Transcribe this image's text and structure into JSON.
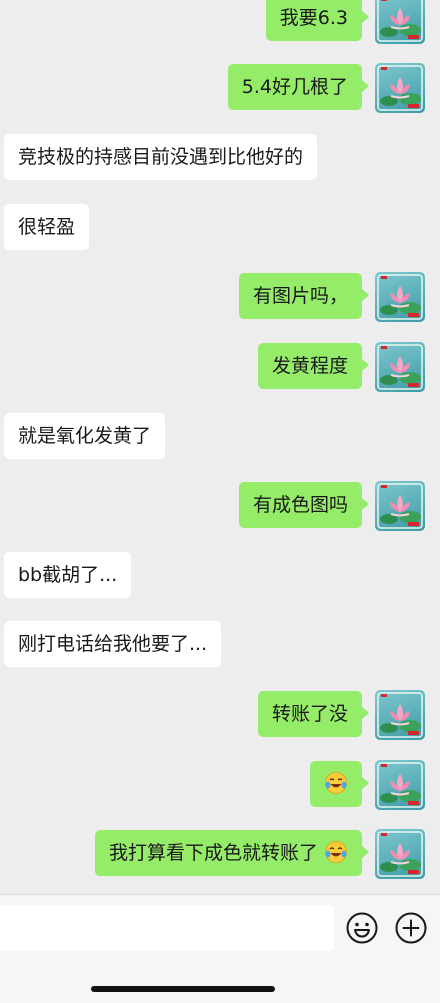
{
  "messages": [
    {
      "dir": "out",
      "text": "我要6.3",
      "emoji": false
    },
    {
      "dir": "out",
      "text": "5.4好几根了",
      "emoji": false
    },
    {
      "dir": "in",
      "text": "竞技极的持感目前没遇到比他好的",
      "emoji": false
    },
    {
      "dir": "in",
      "text": "很轻盈",
      "emoji": false
    },
    {
      "dir": "out",
      "text": "有图片吗，",
      "emoji": false
    },
    {
      "dir": "out",
      "text": "发黄程度",
      "emoji": false
    },
    {
      "dir": "in",
      "text": "就是氧化发黄了",
      "emoji": false
    },
    {
      "dir": "out",
      "text": "有成色图吗",
      "emoji": false
    },
    {
      "dir": "in",
      "text": "bb截胡了...",
      "emoji": false
    },
    {
      "dir": "in",
      "text": "刚打电话给我他要了...",
      "emoji": false
    },
    {
      "dir": "out",
      "text": "转账了没",
      "emoji": false
    },
    {
      "dir": "out",
      "text": "",
      "emoji": true
    },
    {
      "dir": "out",
      "text": "我打算看下成色就转账了",
      "emoji": true
    }
  ],
  "composer": {
    "icons": [
      "emoji-icon",
      "plus-icon"
    ]
  },
  "colors": {
    "outgoing_bubble": "#95ec69",
    "incoming_bubble": "#ffffff",
    "background": "#ededed"
  }
}
